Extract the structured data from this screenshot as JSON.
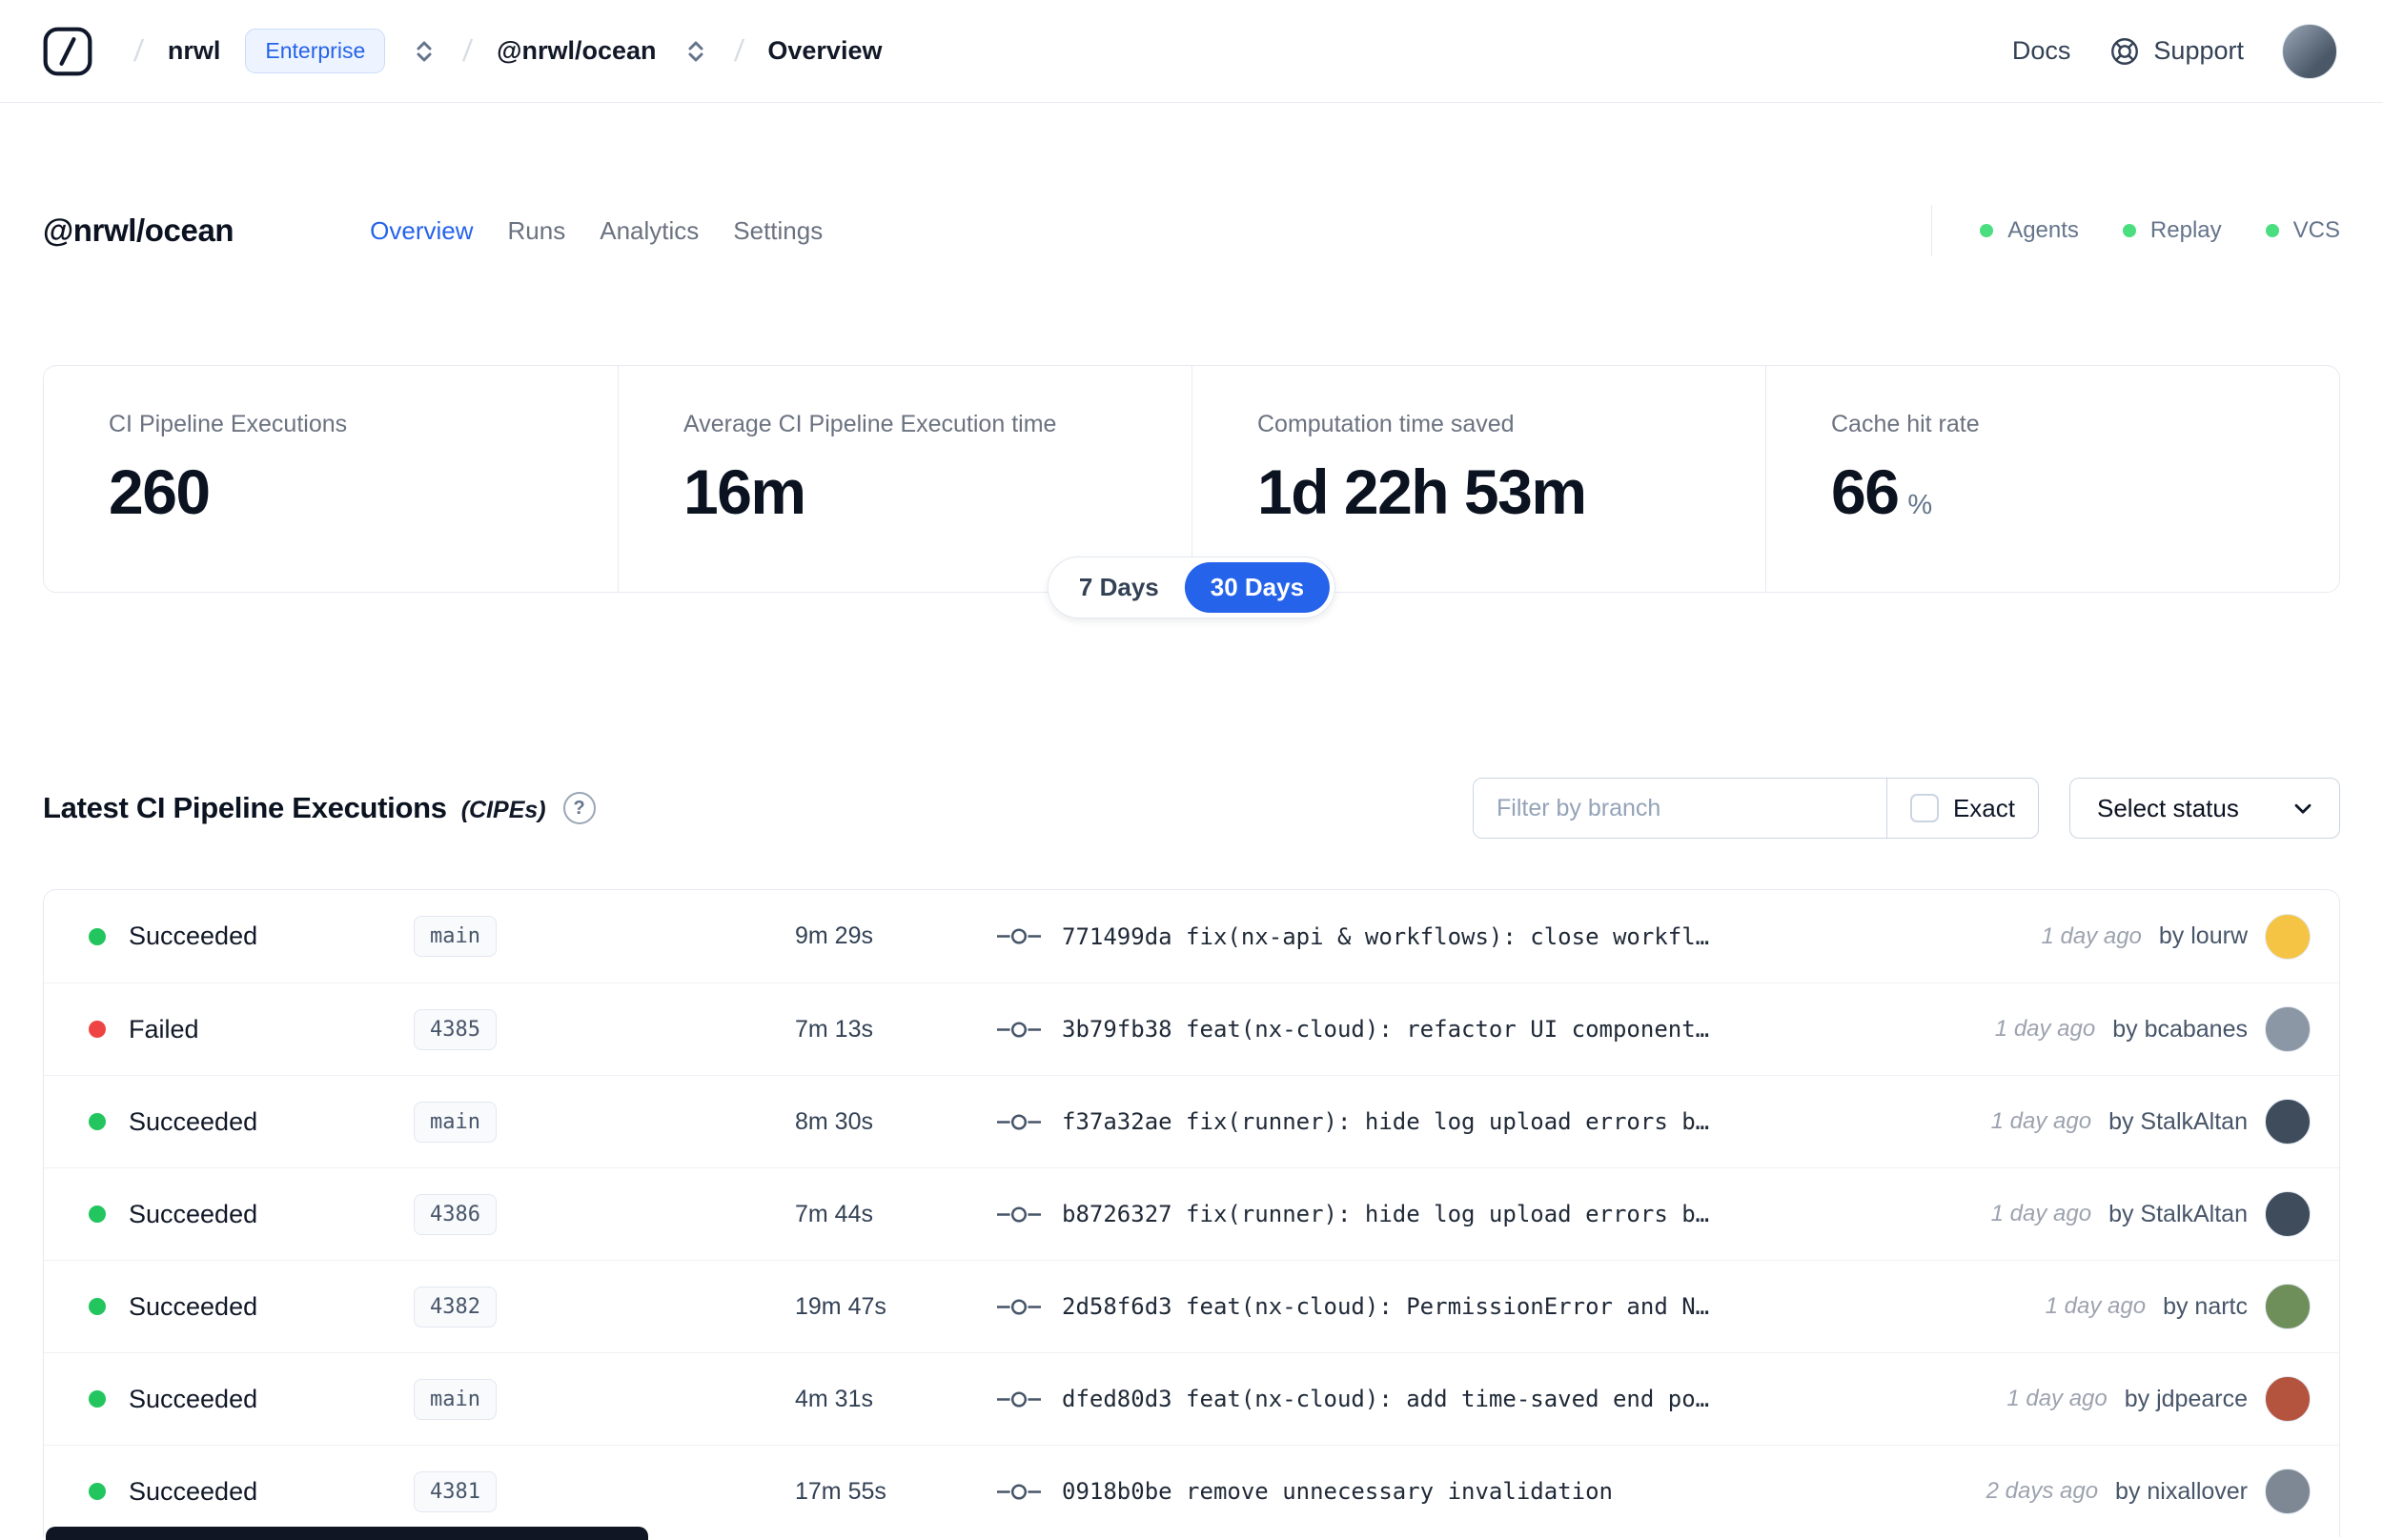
{
  "navbar": {
    "org": "nrwl",
    "org_badge": "Enterprise",
    "workspace": "@nrwl/ocean",
    "page": "Overview",
    "docs": "Docs",
    "support": "Support"
  },
  "header": {
    "title": "@nrwl/ocean",
    "tabs": [
      {
        "label": "Overview",
        "active": true
      },
      {
        "label": "Runs",
        "active": false
      },
      {
        "label": "Analytics",
        "active": false
      },
      {
        "label": "Settings",
        "active": false
      }
    ],
    "legend": [
      {
        "label": "Agents"
      },
      {
        "label": "Replay"
      },
      {
        "label": "VCS"
      }
    ]
  },
  "stats": {
    "cards": [
      {
        "label": "CI Pipeline Executions",
        "value": "260"
      },
      {
        "label": "Average CI Pipeline Execution time",
        "value": "16m"
      },
      {
        "label": "Computation time saved",
        "value": "1d 22h 53m"
      },
      {
        "label": "Cache hit rate",
        "value": "66",
        "unit": "%"
      }
    ],
    "range": {
      "options": [
        {
          "label": "7 Days",
          "active": false
        },
        {
          "label": "30 Days",
          "active": true
        }
      ],
      "selected": "30 Days"
    }
  },
  "cipe_section": {
    "title": "Latest CI Pipeline Executions",
    "title_suffix": "(CIPEs)",
    "filter_placeholder": "Filter by branch",
    "exact_label": "Exact",
    "status_select_label": "Select status"
  },
  "rows": [
    {
      "kind": "success",
      "status": "Succeeded",
      "branch": "main",
      "duration": "9m 29s",
      "commit": "771499da fix(nx-api & workflows): close workfl…",
      "time": "1 day ago",
      "author": "by lourw",
      "avatar_color": "#f6c445"
    },
    {
      "kind": "failed",
      "status": "Failed",
      "branch": "4385",
      "duration": "7m 13s",
      "commit": "3b79fb38 feat(nx-cloud): refactor UI component…",
      "time": "1 day ago",
      "author": "by bcabanes",
      "avatar_color": "#8c97a5"
    },
    {
      "kind": "success",
      "status": "Succeeded",
      "branch": "main",
      "duration": "8m 30s",
      "commit": "f37a32ae fix(runner): hide log upload errors b…",
      "time": "1 day ago",
      "author": "by StalkAltan",
      "avatar_color": "#3f4c5c"
    },
    {
      "kind": "success",
      "status": "Succeeded",
      "branch": "4386",
      "duration": "7m 44s",
      "commit": "b8726327 fix(runner): hide log upload errors b…",
      "time": "1 day ago",
      "author": "by StalkAltan",
      "avatar_color": "#3f4c5c"
    },
    {
      "kind": "success",
      "status": "Succeeded",
      "branch": "4382",
      "duration": "19m 47s",
      "commit": "2d58f6d3 feat(nx-cloud): PermissionError and N…",
      "time": "1 day ago",
      "author": "by nartc",
      "avatar_color": "#6f8f5a"
    },
    {
      "kind": "success",
      "status": "Succeeded",
      "branch": "main",
      "duration": "4m 31s",
      "commit": "dfed80d3 feat(nx-cloud): add time-saved end po…",
      "time": "1 day ago",
      "author": "by jdpearce",
      "avatar_color": "#b4543e"
    },
    {
      "kind": "success",
      "status": "Succeeded",
      "branch": "4381",
      "duration": "17m 55s",
      "commit": "0918b0be remove unnecessary invalidation",
      "time": "2 days ago",
      "author": "by nixallover",
      "avatar_color": "#7d8894"
    }
  ],
  "colors": {
    "accent": "#2563eb",
    "success": "#22c55e",
    "failed": "#ef4444",
    "legend_dot": "#4ade80"
  },
  "icons": {
    "help_glyph": "?"
  }
}
